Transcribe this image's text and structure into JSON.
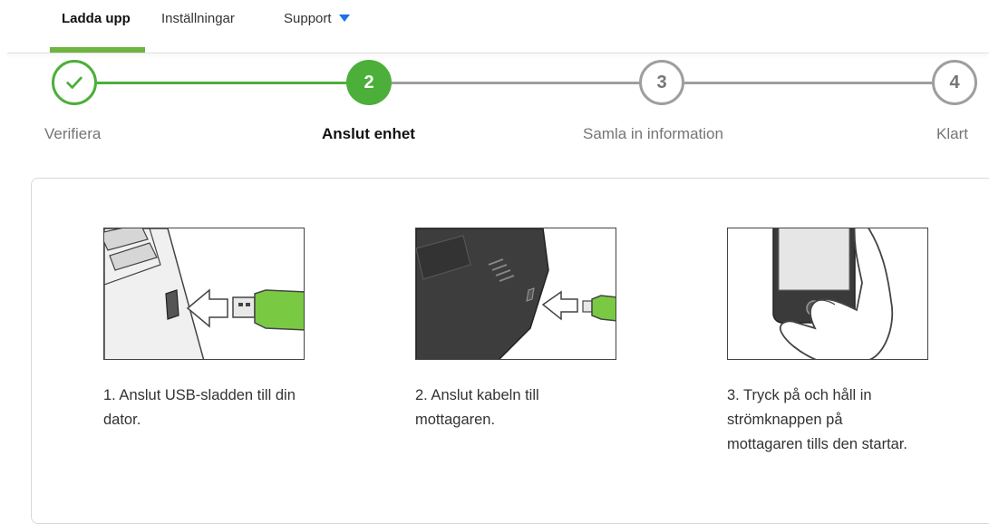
{
  "nav": {
    "items": [
      {
        "label": "Ladda upp"
      },
      {
        "label": "Inställningar"
      },
      {
        "label": "Support"
      }
    ]
  },
  "stepper": {
    "steps": [
      {
        "number": "✓",
        "label": "Verifiera",
        "state": "done"
      },
      {
        "number": "2",
        "label": "Anslut enhet",
        "state": "active"
      },
      {
        "number": "3",
        "label": "Samla in information",
        "state": "todo"
      },
      {
        "number": "4",
        "label": "Klart",
        "state": "todo"
      }
    ]
  },
  "instructions": [
    {
      "text": "1. Anslut USB-sladden till din dator."
    },
    {
      "text": "2. Anslut kabeln till mottagaren."
    },
    {
      "text": "3. Tryck på och håll in strömknappen på mottagaren tills den startar."
    }
  ],
  "colors": {
    "accent_green": "#4caf3a",
    "usb_green": "#7ac943",
    "inactive_gray": "#9e9e9e",
    "support_caret": "#1a73e8"
  }
}
